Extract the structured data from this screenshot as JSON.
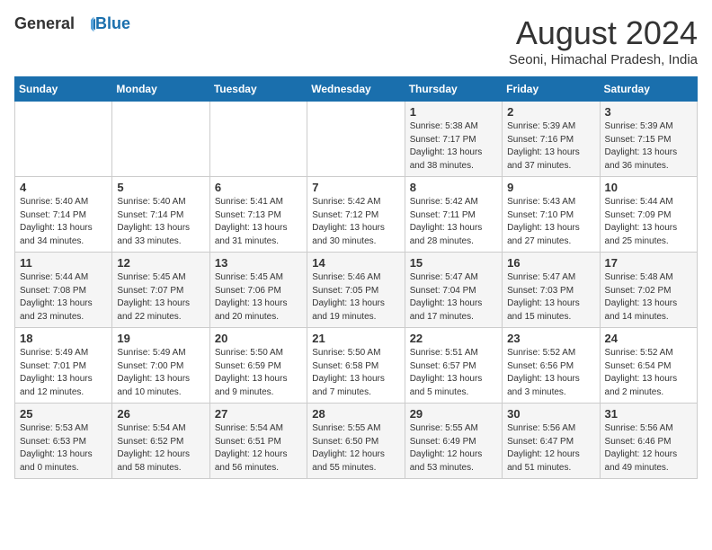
{
  "logo": {
    "general": "General",
    "blue": "Blue"
  },
  "title": "August 2024",
  "subtitle": "Seoni, Himachal Pradesh, India",
  "days_of_week": [
    "Sunday",
    "Monday",
    "Tuesday",
    "Wednesday",
    "Thursday",
    "Friday",
    "Saturday"
  ],
  "weeks": [
    [
      {
        "day": "",
        "info": ""
      },
      {
        "day": "",
        "info": ""
      },
      {
        "day": "",
        "info": ""
      },
      {
        "day": "",
        "info": ""
      },
      {
        "day": "1",
        "info": "Sunrise: 5:38 AM\nSunset: 7:17 PM\nDaylight: 13 hours\nand 38 minutes."
      },
      {
        "day": "2",
        "info": "Sunrise: 5:39 AM\nSunset: 7:16 PM\nDaylight: 13 hours\nand 37 minutes."
      },
      {
        "day": "3",
        "info": "Sunrise: 5:39 AM\nSunset: 7:15 PM\nDaylight: 13 hours\nand 36 minutes."
      }
    ],
    [
      {
        "day": "4",
        "info": "Sunrise: 5:40 AM\nSunset: 7:14 PM\nDaylight: 13 hours\nand 34 minutes."
      },
      {
        "day": "5",
        "info": "Sunrise: 5:40 AM\nSunset: 7:14 PM\nDaylight: 13 hours\nand 33 minutes."
      },
      {
        "day": "6",
        "info": "Sunrise: 5:41 AM\nSunset: 7:13 PM\nDaylight: 13 hours\nand 31 minutes."
      },
      {
        "day": "7",
        "info": "Sunrise: 5:42 AM\nSunset: 7:12 PM\nDaylight: 13 hours\nand 30 minutes."
      },
      {
        "day": "8",
        "info": "Sunrise: 5:42 AM\nSunset: 7:11 PM\nDaylight: 13 hours\nand 28 minutes."
      },
      {
        "day": "9",
        "info": "Sunrise: 5:43 AM\nSunset: 7:10 PM\nDaylight: 13 hours\nand 27 minutes."
      },
      {
        "day": "10",
        "info": "Sunrise: 5:44 AM\nSunset: 7:09 PM\nDaylight: 13 hours\nand 25 minutes."
      }
    ],
    [
      {
        "day": "11",
        "info": "Sunrise: 5:44 AM\nSunset: 7:08 PM\nDaylight: 13 hours\nand 23 minutes."
      },
      {
        "day": "12",
        "info": "Sunrise: 5:45 AM\nSunset: 7:07 PM\nDaylight: 13 hours\nand 22 minutes."
      },
      {
        "day": "13",
        "info": "Sunrise: 5:45 AM\nSunset: 7:06 PM\nDaylight: 13 hours\nand 20 minutes."
      },
      {
        "day": "14",
        "info": "Sunrise: 5:46 AM\nSunset: 7:05 PM\nDaylight: 13 hours\nand 19 minutes."
      },
      {
        "day": "15",
        "info": "Sunrise: 5:47 AM\nSunset: 7:04 PM\nDaylight: 13 hours\nand 17 minutes."
      },
      {
        "day": "16",
        "info": "Sunrise: 5:47 AM\nSunset: 7:03 PM\nDaylight: 13 hours\nand 15 minutes."
      },
      {
        "day": "17",
        "info": "Sunrise: 5:48 AM\nSunset: 7:02 PM\nDaylight: 13 hours\nand 14 minutes."
      }
    ],
    [
      {
        "day": "18",
        "info": "Sunrise: 5:49 AM\nSunset: 7:01 PM\nDaylight: 13 hours\nand 12 minutes."
      },
      {
        "day": "19",
        "info": "Sunrise: 5:49 AM\nSunset: 7:00 PM\nDaylight: 13 hours\nand 10 minutes."
      },
      {
        "day": "20",
        "info": "Sunrise: 5:50 AM\nSunset: 6:59 PM\nDaylight: 13 hours\nand 9 minutes."
      },
      {
        "day": "21",
        "info": "Sunrise: 5:50 AM\nSunset: 6:58 PM\nDaylight: 13 hours\nand 7 minutes."
      },
      {
        "day": "22",
        "info": "Sunrise: 5:51 AM\nSunset: 6:57 PM\nDaylight: 13 hours\nand 5 minutes."
      },
      {
        "day": "23",
        "info": "Sunrise: 5:52 AM\nSunset: 6:56 PM\nDaylight: 13 hours\nand 3 minutes."
      },
      {
        "day": "24",
        "info": "Sunrise: 5:52 AM\nSunset: 6:54 PM\nDaylight: 13 hours\nand 2 minutes."
      }
    ],
    [
      {
        "day": "25",
        "info": "Sunrise: 5:53 AM\nSunset: 6:53 PM\nDaylight: 13 hours\nand 0 minutes."
      },
      {
        "day": "26",
        "info": "Sunrise: 5:54 AM\nSunset: 6:52 PM\nDaylight: 12 hours\nand 58 minutes."
      },
      {
        "day": "27",
        "info": "Sunrise: 5:54 AM\nSunset: 6:51 PM\nDaylight: 12 hours\nand 56 minutes."
      },
      {
        "day": "28",
        "info": "Sunrise: 5:55 AM\nSunset: 6:50 PM\nDaylight: 12 hours\nand 55 minutes."
      },
      {
        "day": "29",
        "info": "Sunrise: 5:55 AM\nSunset: 6:49 PM\nDaylight: 12 hours\nand 53 minutes."
      },
      {
        "day": "30",
        "info": "Sunrise: 5:56 AM\nSunset: 6:47 PM\nDaylight: 12 hours\nand 51 minutes."
      },
      {
        "day": "31",
        "info": "Sunrise: 5:56 AM\nSunset: 6:46 PM\nDaylight: 12 hours\nand 49 minutes."
      }
    ]
  ]
}
